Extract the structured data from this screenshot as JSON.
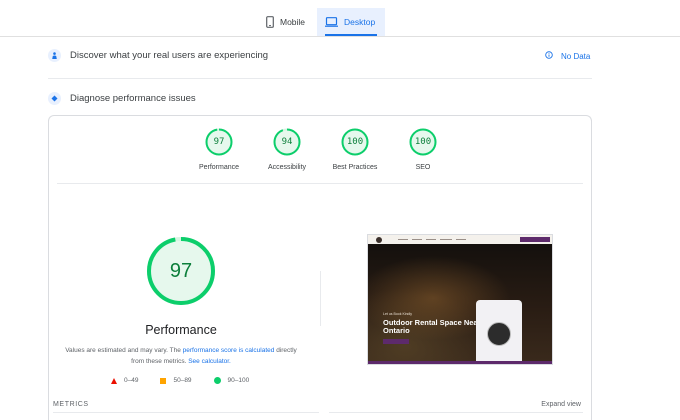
{
  "device_tabs": {
    "mobile": {
      "label": "Mobile",
      "icon": "smartphone-icon"
    },
    "desktop": {
      "label": "Desktop",
      "icon": "laptop-icon",
      "selected": true
    }
  },
  "sections": {
    "discover": {
      "title": "Discover what your real users are experiencing",
      "status": "No Data"
    },
    "diagnose": {
      "title": "Diagnose performance issues"
    }
  },
  "scores": [
    {
      "label": "Performance",
      "value": "97",
      "fraction": 0.97
    },
    {
      "label": "Accessibility",
      "value": "94",
      "fraction": 0.94
    },
    {
      "label": "Best Practices",
      "value": "100",
      "fraction": 1.0
    },
    {
      "label": "SEO",
      "value": "100",
      "fraction": 1.0
    }
  ],
  "main_score": {
    "value": "97",
    "fraction": 0.97,
    "title": "Performance",
    "desc_part1": "Values are estimated and may vary. The ",
    "desc_link1": "performance score is calculated",
    "desc_part2": " directly from these metrics. ",
    "desc_link2": "See calculator."
  },
  "legend": {
    "poor": "0–49",
    "average": "50–89",
    "good": "90–100"
  },
  "metrics": {
    "label": "METRICS",
    "expand": "Expand view"
  },
  "screenshot": {
    "kicker": "Let us Book Kindly",
    "headline": "Outdoor Rental Space Near Ontario"
  },
  "colors": {
    "accent": "#1a73e8",
    "pass": "#0cce6b",
    "pass_text": "#0c7f3b",
    "average": "#ffa400",
    "fail": "#eb0f00"
  }
}
